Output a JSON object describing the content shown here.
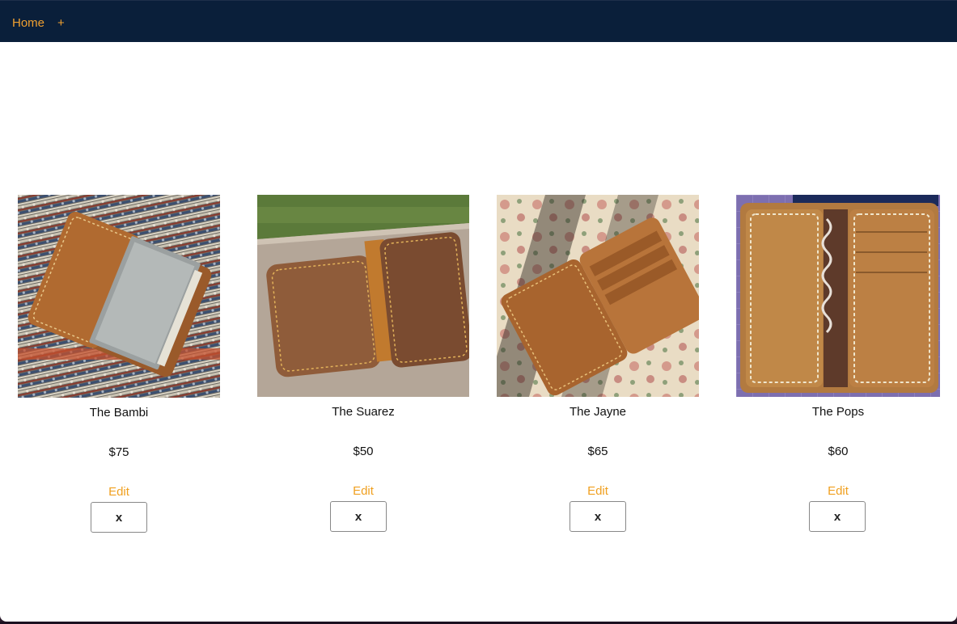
{
  "nav": {
    "home_label": "Home",
    "add_label": "+"
  },
  "products": [
    {
      "name": "The Bambi",
      "price": "$75",
      "edit_label": "Edit",
      "delete_label": "x"
    },
    {
      "name": "The Suarez",
      "price": "$50",
      "edit_label": "Edit",
      "delete_label": "x"
    },
    {
      "name": "The Jayne",
      "price": "$65",
      "edit_label": "Edit",
      "delete_label": "x"
    },
    {
      "name": "The Pops",
      "price": "$60",
      "edit_label": "Edit",
      "delete_label": "x"
    }
  ],
  "colors": {
    "navbar_bg": "#0a1f3a",
    "accent": "#f0a020"
  }
}
